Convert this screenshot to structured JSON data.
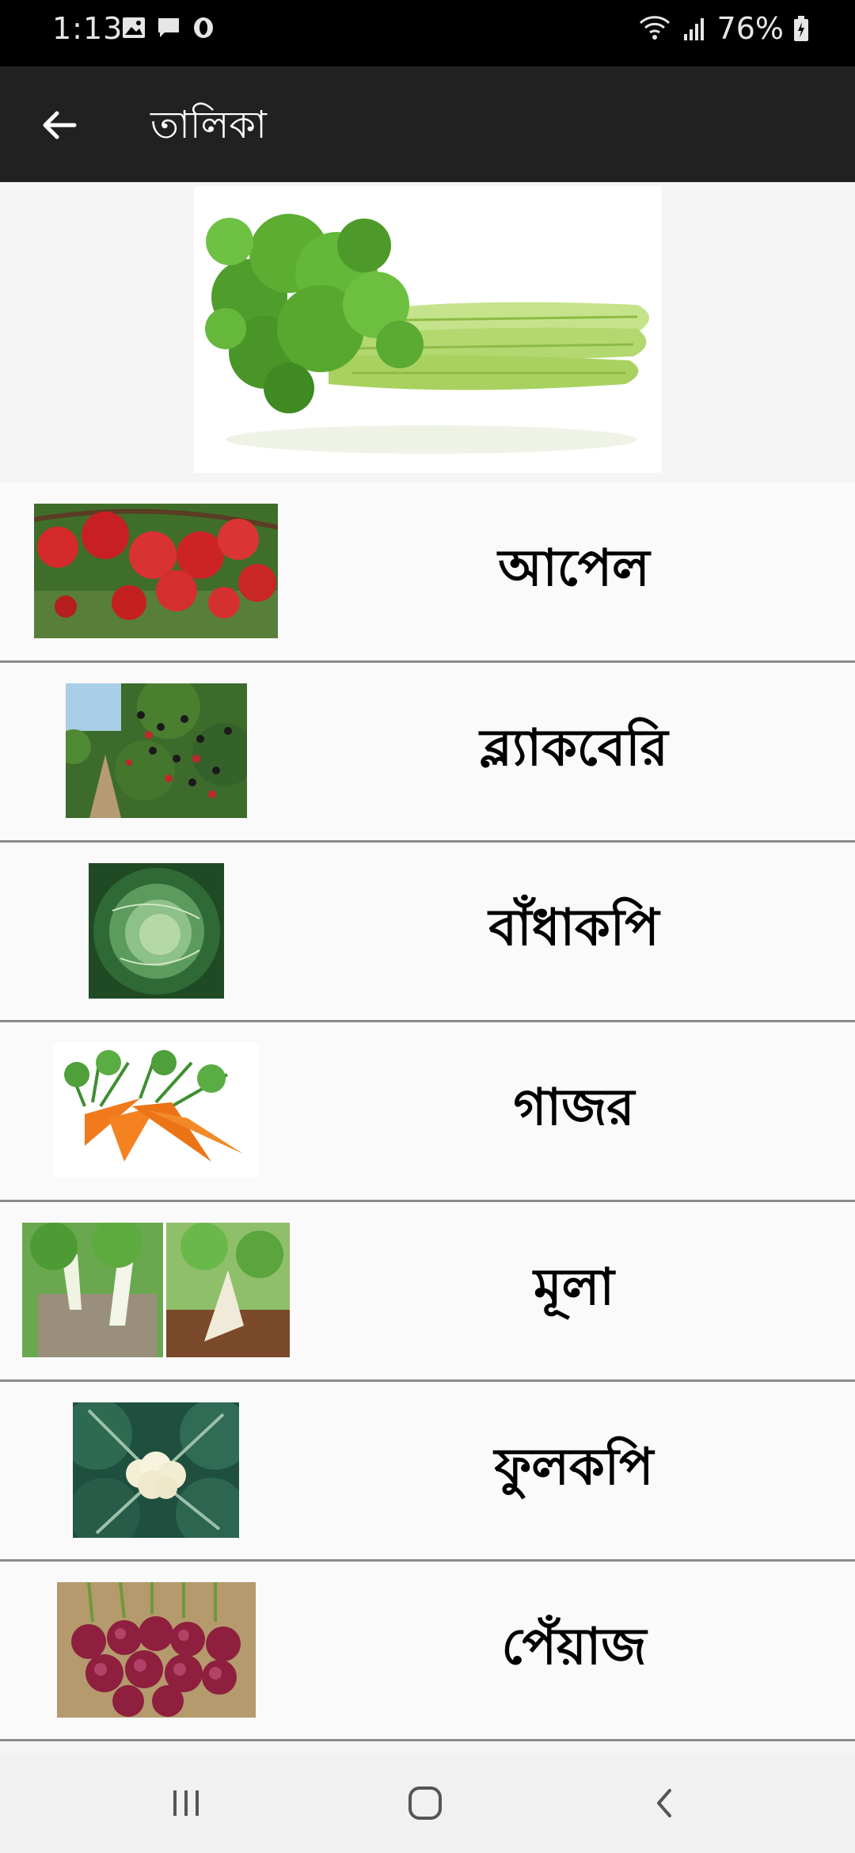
{
  "status": {
    "time": "1:13",
    "battery": "76%",
    "icons_left": [
      "image-icon",
      "message-icon",
      "opera-icon"
    ],
    "icons_right": [
      "wifi-icon",
      "signal-icon",
      "battery-icon"
    ]
  },
  "app_bar": {
    "title": "তালিকা",
    "back_icon": "arrow-left-icon"
  },
  "hero": {
    "image": "celery-image"
  },
  "items": [
    {
      "label": "আপেল",
      "image": "apples-image"
    },
    {
      "label": "ব্ল্যাকবেরি",
      "image": "blackberries-image"
    },
    {
      "label": "বাঁধাকপি",
      "image": "cabbage-image"
    },
    {
      "label": "গাজর",
      "image": "carrots-image"
    },
    {
      "label": "মূলা",
      "image": "radish-image"
    },
    {
      "label": "ফুলকপি",
      "image": "cauliflower-image"
    },
    {
      "label": "পেঁয়াজ",
      "image": "onions-image"
    }
  ],
  "nav": {
    "buttons": [
      "recents-icon",
      "home-icon",
      "back-icon"
    ]
  },
  "colors": {
    "status_bar": "#000000",
    "app_bar": "#212121",
    "background": "#f5f5f5",
    "divider": "#8a8a8a",
    "nav_bar": "#f1f1f1"
  }
}
